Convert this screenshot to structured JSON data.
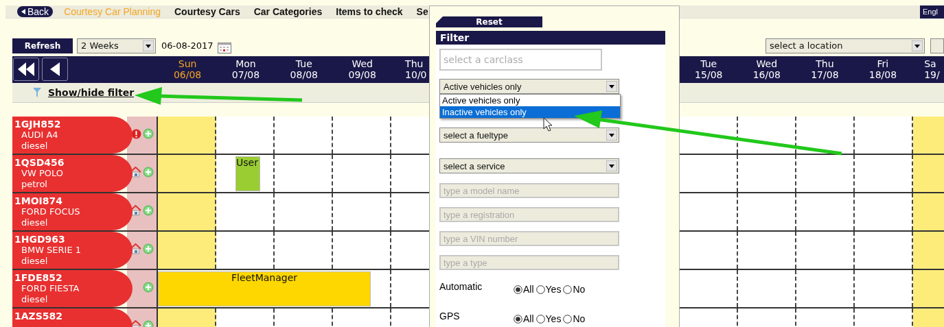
{
  "nav": {
    "back": "Back",
    "items": [
      {
        "label": "Courtesy Car Planning",
        "selected": true
      },
      {
        "label": "Courtesy Cars",
        "selected": false
      },
      {
        "label": "Car Categories",
        "selected": false
      },
      {
        "label": "Items to check",
        "selected": false
      },
      {
        "label": "Se",
        "selected": false
      }
    ],
    "language": "Engl"
  },
  "toolbar": {
    "refresh": "Refresh",
    "period": "2 Weeks",
    "date": "06-08-2017",
    "location": "select a location"
  },
  "days_left": [
    {
      "day": "Sun",
      "date": "06/08",
      "today": true,
      "weekend": true
    },
    {
      "day": "Mon",
      "date": "07/08",
      "today": false,
      "weekend": false
    },
    {
      "day": "Tue",
      "date": "08/08",
      "today": false,
      "weekend": false
    },
    {
      "day": "Wed",
      "date": "09/08",
      "today": false,
      "weekend": false
    },
    {
      "day": "Thu",
      "date": "10/0",
      "today": false,
      "weekend": false
    }
  ],
  "days_right": [
    {
      "day": "Tue",
      "date": "15/08",
      "today": false,
      "weekend": false
    },
    {
      "day": "Wed",
      "date": "16/08",
      "today": false,
      "weekend": false
    },
    {
      "day": "Thu",
      "date": "17/08",
      "today": false,
      "weekend": false
    },
    {
      "day": "Fri",
      "date": "18/08",
      "today": false,
      "weekend": false
    },
    {
      "day": "Sa",
      "date": "19/",
      "today": false,
      "weekend": true
    }
  ],
  "filter_toggle": "Show/hide filter",
  "vehicles": [
    {
      "plate": "1GJH852",
      "model": "AUDI A4",
      "fuel": "diesel",
      "kind": "alert"
    },
    {
      "plate": "1QSD456",
      "model": "VW POLO",
      "fuel": "petrol",
      "kind": "home",
      "booking": {
        "label": "User",
        "kind": "short",
        "color": "#9acd32"
      }
    },
    {
      "plate": "1MOI874",
      "model": "FORD FOCUS",
      "fuel": "diesel",
      "kind": "home"
    },
    {
      "plate": "1HGD963",
      "model": "BMW SERIE 1",
      "fuel": "diesel",
      "kind": "home"
    },
    {
      "plate": "1FDE852",
      "model": "FORD FIESTA",
      "fuel": "diesel",
      "kind": "plain",
      "booking": {
        "label": "FleetManager",
        "kind": "long",
        "color": "#ffd700"
      }
    },
    {
      "plate": "1AZS582",
      "kind": "home"
    }
  ],
  "filter_panel": {
    "reset": "Reset",
    "title": "Filter",
    "carclass_placeholder": "select a carclass",
    "vehicle_state": {
      "value": "Active vehicles only",
      "expanded": true,
      "options": [
        {
          "label": "Active vehicles only",
          "highlighted": false
        },
        {
          "label": "Inactive vehicles only",
          "highlighted": true
        }
      ]
    },
    "fueltype": "select a fueltype",
    "service": "select a service",
    "text_fields": [
      {
        "placeholder": "type a model name"
      },
      {
        "placeholder": "type a registration"
      },
      {
        "placeholder": "type a VIN number"
      },
      {
        "placeholder": "type a type"
      }
    ],
    "radio_groups": [
      {
        "label": "Automatic",
        "options": [
          {
            "label": "All",
            "selected": true
          },
          {
            "label": "Yes",
            "selected": false
          },
          {
            "label": "No",
            "selected": false
          }
        ]
      },
      {
        "label": "GPS",
        "options": [
          {
            "label": "All",
            "selected": true
          },
          {
            "label": "Yes",
            "selected": false
          },
          {
            "label": "No",
            "selected": false
          }
        ]
      }
    ]
  }
}
